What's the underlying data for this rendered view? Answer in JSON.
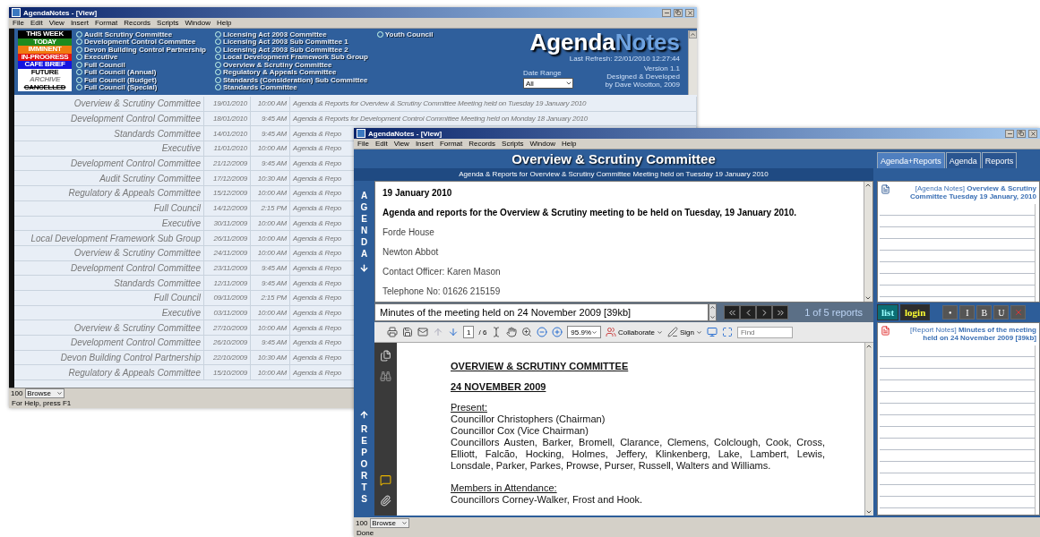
{
  "back_window": {
    "title": "AgendaNotes - [View]",
    "menu": [
      "File",
      "Edit",
      "View",
      "Insert",
      "Format",
      "Records",
      "Scripts",
      "Window",
      "Help"
    ],
    "legend": [
      {
        "label": "THIS WEEK",
        "color": "#000000",
        "kind": "filled"
      },
      {
        "label": "TODAY",
        "color": "#1e8a1e",
        "kind": "filled"
      },
      {
        "label": "IMMINENT",
        "color": "#f07a10",
        "kind": "filled"
      },
      {
        "label": "IN-PROGRESS",
        "color": "#e01010",
        "kind": "filled"
      },
      {
        "label": "CAFE BRIEF",
        "color": "#1414e0",
        "kind": "filled"
      },
      {
        "label": "FUTURE",
        "color": "#ffffff",
        "kind": "plain"
      },
      {
        "label": "ARCHIVE",
        "color": "#ffffff",
        "kind": "muted"
      },
      {
        "label": "CANCELLED",
        "color": "#ffffff",
        "kind": "struck"
      }
    ],
    "committee_filter": [
      [
        {
          "label": "Audit Scrutiny Committee",
          "selected": false
        },
        {
          "label": "Development Control Committee",
          "selected": false
        },
        {
          "label": "Devon Building Control Partnership",
          "selected": false
        },
        {
          "label": "Executive",
          "selected": false
        },
        {
          "label": "Full Council",
          "selected": false
        },
        {
          "label": "Full Council (Annual)",
          "selected": false
        },
        {
          "label": "Full Council (Budget)",
          "selected": false
        },
        {
          "label": "Full Council (Special)",
          "selected": false
        }
      ],
      [
        {
          "label": "Licensing Act 2003 Committee",
          "selected": false
        },
        {
          "label": "Licensing Act 2003 Sub Committee 1",
          "selected": false
        },
        {
          "label": "Licensing Act 2003 Sub Committee 2",
          "selected": false
        },
        {
          "label": "Local Development Framework Sub Group",
          "selected": false
        },
        {
          "label": "Overview & Scrutiny Committee",
          "selected": false
        },
        {
          "label": "Regulatory & Appeals Committee",
          "selected": false
        },
        {
          "label": "Standards (Consideration) Sub Committee",
          "selected": false
        },
        {
          "label": "Standards Committee",
          "selected": false
        }
      ],
      [
        {
          "label": "Youth Council",
          "selected": false
        }
      ]
    ],
    "logo": {
      "first": "Agenda",
      "second": "Notes"
    },
    "last_refresh": "Last Refresh: 22/01/2010 12:27:44",
    "date_range": {
      "label": "Date Range",
      "value": "All"
    },
    "credits": [
      "Version 1.1",
      "Designed & Developed",
      "by Dave Wootton, 2009"
    ],
    "meetings": [
      {
        "committee": "Overview & Scrutiny Committee",
        "date": "19/01/2010",
        "time": "10:00 AM",
        "description": "Agenda & Reports for Overview & Scrutiny Committee Meeting held on Tuesday 19 January 2010"
      },
      {
        "committee": "Development Control Committee",
        "date": "18/01/2010",
        "time": "9:45 AM",
        "description": "Agenda & Reports for Development Control Committee Meeting held on Monday 18 January 2010"
      },
      {
        "committee": "Standards Committee",
        "date": "14/01/2010",
        "time": "9:45 AM",
        "description": "Agenda & Repo"
      },
      {
        "committee": "Executive",
        "date": "11/01/2010",
        "time": "10:00 AM",
        "description": "Agenda & Repo"
      },
      {
        "committee": "Development Control Committee",
        "date": "21/12/2009",
        "time": "9:45 AM",
        "description": "Agenda & Repo"
      },
      {
        "committee": "Audit Scrutiny Committee",
        "date": "17/12/2009",
        "time": "10:30 AM",
        "description": "Agenda & Repo"
      },
      {
        "committee": "Regulatory & Appeals Committee",
        "date": "15/12/2009",
        "time": "10:00 AM",
        "description": "Agenda & Repo"
      },
      {
        "committee": "Full Council",
        "date": "14/12/2009",
        "time": "2:15 PM",
        "description": "Agenda & Repo"
      },
      {
        "committee": "Executive",
        "date": "30/11/2009",
        "time": "10:00 AM",
        "description": "Agenda & Repo"
      },
      {
        "committee": "Local Development Framework Sub Group",
        "date": "26/11/2009",
        "time": "10:00 AM",
        "description": "Agenda & Repo"
      },
      {
        "committee": "Overview & Scrutiny Committee",
        "date": "24/11/2009",
        "time": "10:00 AM",
        "description": "Agenda & Repo"
      },
      {
        "committee": "Development Control Committee",
        "date": "23/11/2009",
        "time": "9:45 AM",
        "description": "Agenda & Repo"
      },
      {
        "committee": "Standards Committee",
        "date": "12/11/2009",
        "time": "9:45 AM",
        "description": "Agenda & Repo"
      },
      {
        "committee": "Full Council",
        "date": "09/11/2009",
        "time": "2:15 PM",
        "description": "Agenda & Repo"
      },
      {
        "committee": "Executive",
        "date": "03/11/2009",
        "time": "10:00 AM",
        "description": "Agenda & Repo"
      },
      {
        "committee": "Overview & Scrutiny Committee",
        "date": "27/10/2009",
        "time": "10:00 AM",
        "description": "Agenda & Repo"
      },
      {
        "committee": "Development Control Committee",
        "date": "26/10/2009",
        "time": "9:45 AM",
        "description": "Agenda & Repo"
      },
      {
        "committee": "Devon Building Control Partnership",
        "date": "22/10/2009",
        "time": "10:30 AM",
        "description": "Agenda & Repo"
      },
      {
        "committee": "Regulatory & Appeals Committee",
        "date": "15/10/2009",
        "time": "10:00 AM",
        "description": "Agenda & Repo"
      }
    ],
    "zoom": "100",
    "mode": "Browse",
    "status_text": "For Help, press F1"
  },
  "front_window": {
    "title": "AgendaNotes - [View]",
    "menu": [
      "File",
      "Edit",
      "View",
      "Insert",
      "Format",
      "Records",
      "Scripts",
      "Window",
      "Help"
    ],
    "header": {
      "title": "Overview & Scrutiny Committee",
      "subtitle": "Agenda & Reports for Overview & Scrutiny Committee Meeting held on Tuesday 19 January 2010"
    },
    "tabs": [
      {
        "label": "Agenda+Reports",
        "selected": true
      },
      {
        "label": "Agenda",
        "selected": false
      },
      {
        "label": "Reports",
        "selected": false
      }
    ],
    "agenda_label": "AGENDA",
    "agenda": [
      {
        "text": "19 January 2010",
        "kind": "bold"
      },
      {
        "text": "Agenda and reports for the Overview & Scrutiny meeting to be held on Tuesday, 19 January 2010.",
        "kind": "bold"
      },
      {
        "text": "Forde House",
        "kind": "plain"
      },
      {
        "text": "Newton Abbot",
        "kind": "plain"
      },
      {
        "text": "Contact Officer: Karen Mason",
        "kind": "plain"
      },
      {
        "text": "Telephone No: 01626 215159",
        "kind": "plain"
      }
    ],
    "report_file": "Minutes of the meeting held on 24 November 2009 [39kb]",
    "report_count": "1 of 5 reports",
    "reports_label": "REPORTS",
    "pdf_toolbar": {
      "page": "1",
      "pages": "/ 6",
      "zoom": "95.9%",
      "collaborate": "Collaborate",
      "sign": "Sign",
      "find_placeholder": "Find"
    },
    "document": {
      "headings": [
        "OVERVIEW & SCRUTINY COMMITTEE",
        "24 NOVEMBER 2009"
      ],
      "sections": [
        {
          "heading": "Present:",
          "lines": [
            "Councillor Christophers (Chairman)",
            "Councillor Cox (Vice Chairman)",
            "Councillors Austen, Barker, Bromell, Clarance, Clemens, Colclough, Cook, Cross, Elliott, Falcão, Hocking, Holmes, Jeffery, Klinkenberg, Lake, Lambert, Lewis, Lonsdale, Parker, Parkes, Prowse, Purser, Russell, Walters and Williams."
          ]
        },
        {
          "heading": "Members in Attendance:",
          "lines": [
            "Councillors Corney-Walker, Frost and Hook."
          ]
        }
      ]
    },
    "agenda_note": {
      "tag": "[Agenda Notes]",
      "title": "Overview & Scrutiny Committee Tuesday 19 January, 2010"
    },
    "note_buttons": [
      {
        "label": "list",
        "kind": "list"
      },
      {
        "label": "login",
        "kind": "login"
      }
    ],
    "format_buttons": [
      "•",
      "I",
      "B",
      "U"
    ],
    "report_note": {
      "tag": "[Report Notes]",
      "title": "Minutes of the meeting held on 24 November 2009 [39kb]"
    },
    "zoom": "100",
    "mode": "Browse",
    "status_text": "Done"
  }
}
